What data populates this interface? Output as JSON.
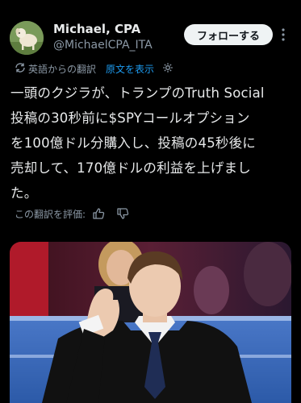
{
  "author": {
    "display_name": "Michael, CPA",
    "handle": "@MichaelCPA_ITA",
    "avatar_icon": "dog-avatar"
  },
  "header": {
    "follow_label": "フォローする",
    "more_icon": "more-vertical-icon"
  },
  "translation": {
    "label": "英語からの翻訳",
    "show_original": "原文を表示",
    "translate_icon": "translate-icon",
    "settings_icon": "gear-icon"
  },
  "tweet": {
    "lines": [
      "一頭のクジラが、トランプのTruth Social",
      "投稿の30秒前に$SPYコールオプション",
      "を100億ドル分購入し、投稿の45秒後に",
      "売却して、170億ドルの利益を上げまし",
      "た。"
    ]
  },
  "rating": {
    "label": "この翻訳を評価:",
    "up_icon": "thumbs-up-icon",
    "down_icon": "thumbs-down-icon"
  },
  "media": {
    "description_icon": "photo"
  },
  "colors": {
    "background": "#000000",
    "text": "#e7e9ea",
    "muted": "#8b98a5",
    "link": "#1d9bf0",
    "button_bg": "#eff3f4"
  }
}
